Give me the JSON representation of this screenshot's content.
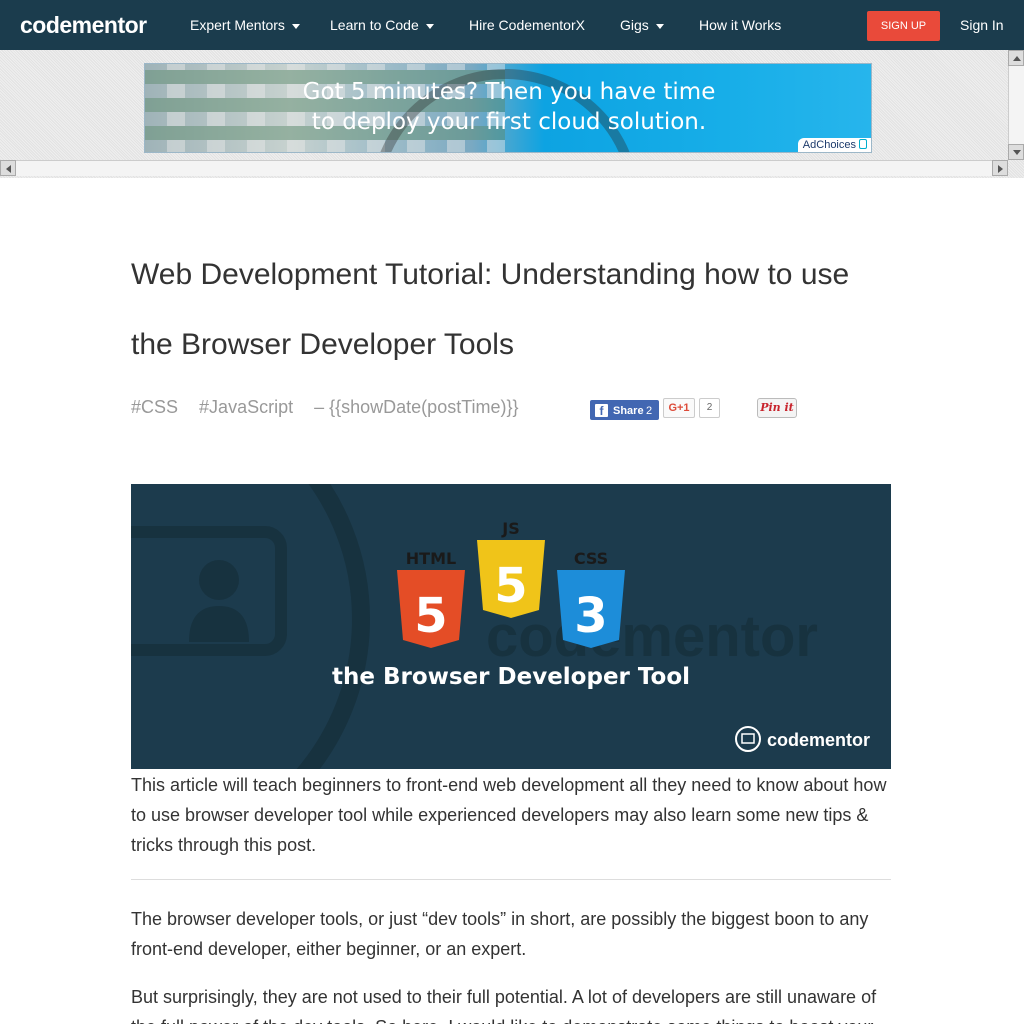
{
  "nav": {
    "logo": "codementor",
    "items": [
      {
        "label": "Expert Mentors",
        "dropdown": true
      },
      {
        "label": "Learn to Code",
        "dropdown": true
      },
      {
        "label": "Hire CodementorX",
        "dropdown": false
      },
      {
        "label": "Gigs",
        "dropdown": true
      },
      {
        "label": "How it Works",
        "dropdown": false
      }
    ],
    "signup": "SIGN UP",
    "signin": "Sign In"
  },
  "ad": {
    "line1": "Got 5 minutes? Then you have time",
    "line2": "to deploy your first cloud solution.",
    "adchoices": "AdChoices"
  },
  "article": {
    "title": "Web Development Tutorial: Understanding how to use the Browser Developer Tools",
    "tags": [
      "#CSS",
      "#JavaScript"
    ],
    "date_placeholder": "– {{showDate(postTime)}}",
    "share": {
      "fb_label": "Share",
      "fb_count": "2",
      "gplus_label": "G+1",
      "gplus_count": "2",
      "pin_label": "Pin it"
    },
    "hero": {
      "badges": [
        "HTML",
        "JS",
        "CSS"
      ],
      "badge_numbers": [
        "5",
        "5",
        "3"
      ],
      "caption": "the Browser Developer Tool",
      "brand": "codementor"
    },
    "paragraphs": [
      "This article will teach beginners to front-end web development all they need to know about how to use browser developer tool while experienced developers may also learn some new tips & tricks through this post.",
      " The browser developer tools, or just “dev tools” in short, are possibly the biggest boon to any front-end developer, either beginner, or an expert.",
      "But surprisingly, they are not used to their full potential. A lot of developers are still unaware of the full power of the dev tools. So here, I would like to demonstrate some things to boost your"
    ]
  },
  "colors": {
    "nav_bg": "#1b3c4d",
    "signup_bg": "#e94a3a",
    "hero_bg": "#1c3b4d",
    "html_orange": "#e44d26",
    "js_yellow": "#f0c419",
    "css_blue": "#1d8dd9"
  }
}
